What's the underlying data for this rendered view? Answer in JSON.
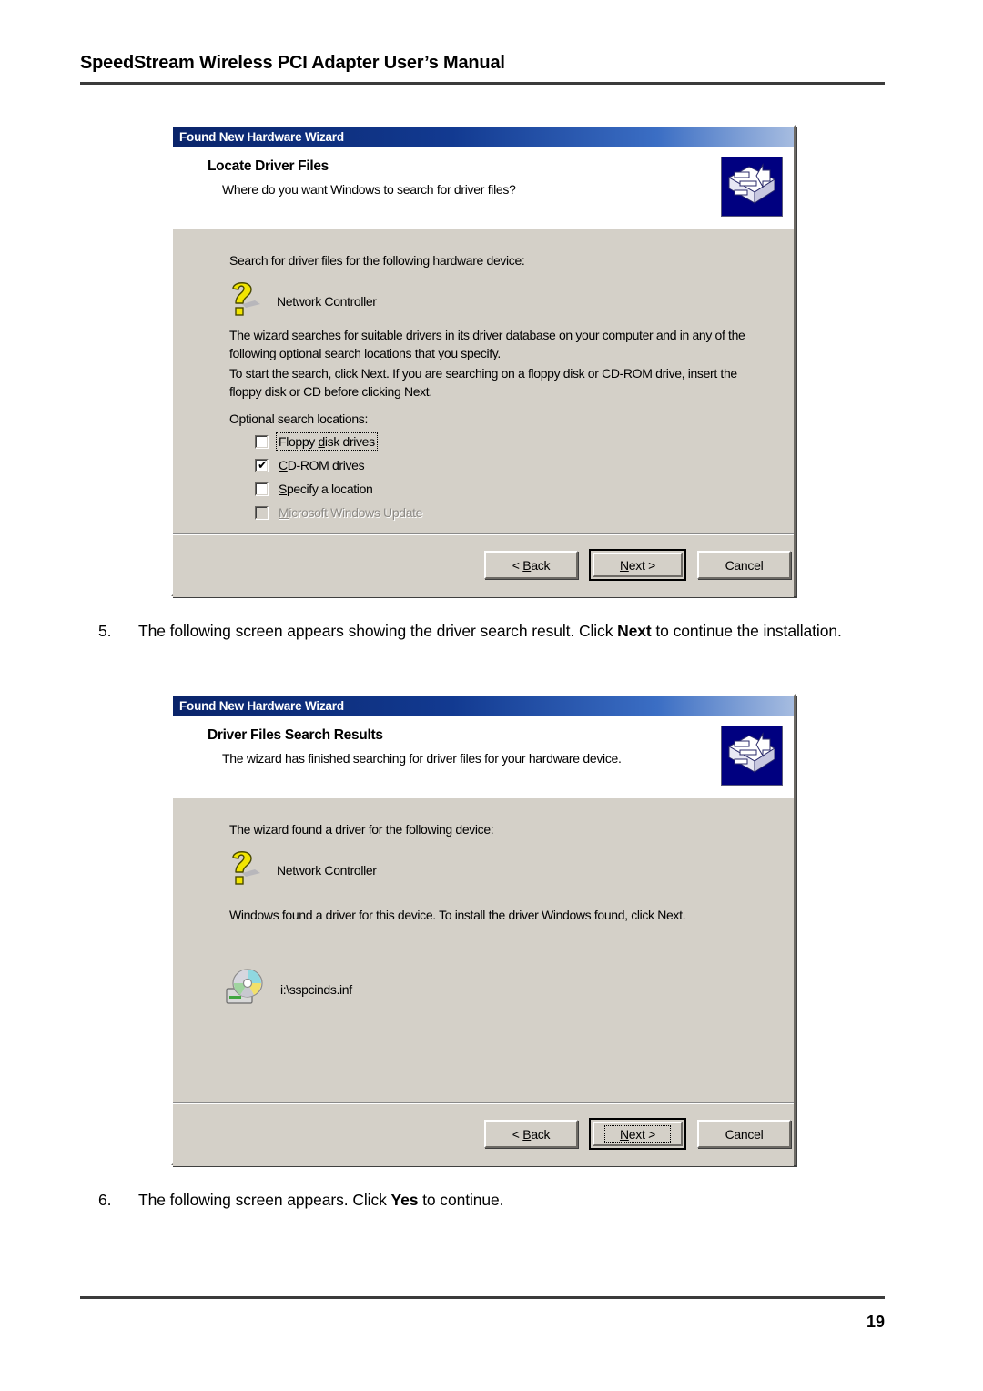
{
  "document": {
    "header_title": "SpeedStream Wireless PCI Adapter User’s Manual",
    "page_number": "19"
  },
  "dialog1": {
    "titlebar": "Found New Hardware Wizard",
    "head_title": "Locate Driver Files",
    "head_sub": "Where do you want Windows to search for driver files?",
    "intro": "Search for driver files for the following hardware device:",
    "device": "Network Controller",
    "para1": "The wizard searches for suitable drivers in its driver database on your computer and in any of the following optional search locations that you specify.",
    "para2": "To start the search, click Next. If you are searching on a floppy disk or CD-ROM drive, insert the floppy disk or CD before clicking Next.",
    "checkbox_group_label": "Optional search locations:",
    "checkboxes": [
      {
        "label_pre": "Floppy ",
        "label_accel": "d",
        "label_post": "isk drives",
        "checked": false,
        "disabled": false,
        "focused": true
      },
      {
        "label_pre": "",
        "label_accel": "C",
        "label_post": "D-ROM drives",
        "checked": true,
        "disabled": false,
        "focused": false
      },
      {
        "label_pre": "",
        "label_accel": "S",
        "label_post": "pecify a location",
        "checked": false,
        "disabled": false,
        "focused": false
      },
      {
        "label_pre": "",
        "label_accel": "M",
        "label_post": "icrosoft Windows Update",
        "checked": false,
        "disabled": true,
        "focused": false
      }
    ],
    "buttons": {
      "back_pre": "< ",
      "back_accel": "B",
      "back_post": "ack",
      "next_accel": "N",
      "next_post": "ext >",
      "cancel": "Cancel"
    }
  },
  "step5": {
    "number": "5.",
    "text_before": "The following screen appears showing the driver search result. Click ",
    "bold": "Next",
    "text_after": " to continue the installation."
  },
  "dialog2": {
    "titlebar": "Found New Hardware Wizard",
    "head_title": "Driver Files Search Results",
    "head_sub": "The wizard has finished searching for driver files for your hardware device.",
    "intro": "The wizard found a driver for the following device:",
    "device": "Network Controller",
    "para1": "Windows found a driver for this device. To install the driver Windows found, click Next.",
    "inf_file": "i:\\sspcinds.inf",
    "buttons": {
      "back_pre": "< ",
      "back_accel": "B",
      "back_post": "ack",
      "next_accel": "N",
      "next_post": "ext >",
      "cancel": "Cancel"
    }
  },
  "step6": {
    "number": "6.",
    "text_before": "The following screen appears. Click ",
    "bold": "Yes",
    "text_after": " to continue."
  },
  "icons": {
    "wizard": "wizard-hardware-icon",
    "unknown_device": "yellow-question-mark-icon",
    "cd": "cd-drive-icon"
  },
  "colors": {
    "titlebar_start": "#0a246a",
    "titlebar_end": "#a6bce0",
    "dialog_face": "#d4d0c8",
    "icon_background": "#000080",
    "rule": "#3b3b3b"
  }
}
